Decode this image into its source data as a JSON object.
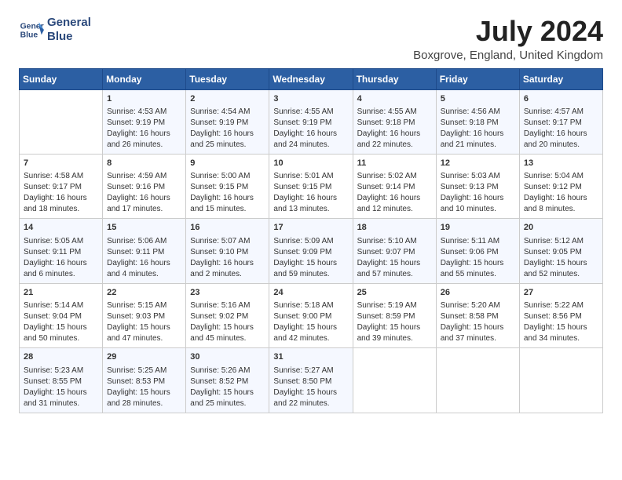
{
  "header": {
    "logo_line1": "General",
    "logo_line2": "Blue",
    "month": "July 2024",
    "location": "Boxgrove, England, United Kingdom"
  },
  "weekdays": [
    "Sunday",
    "Monday",
    "Tuesday",
    "Wednesday",
    "Thursday",
    "Friday",
    "Saturday"
  ],
  "weeks": [
    [
      {
        "day": "",
        "info": ""
      },
      {
        "day": "1",
        "info": "Sunrise: 4:53 AM\nSunset: 9:19 PM\nDaylight: 16 hours\nand 26 minutes."
      },
      {
        "day": "2",
        "info": "Sunrise: 4:54 AM\nSunset: 9:19 PM\nDaylight: 16 hours\nand 25 minutes."
      },
      {
        "day": "3",
        "info": "Sunrise: 4:55 AM\nSunset: 9:19 PM\nDaylight: 16 hours\nand 24 minutes."
      },
      {
        "day": "4",
        "info": "Sunrise: 4:55 AM\nSunset: 9:18 PM\nDaylight: 16 hours\nand 22 minutes."
      },
      {
        "day": "5",
        "info": "Sunrise: 4:56 AM\nSunset: 9:18 PM\nDaylight: 16 hours\nand 21 minutes."
      },
      {
        "day": "6",
        "info": "Sunrise: 4:57 AM\nSunset: 9:17 PM\nDaylight: 16 hours\nand 20 minutes."
      }
    ],
    [
      {
        "day": "7",
        "info": "Sunrise: 4:58 AM\nSunset: 9:17 PM\nDaylight: 16 hours\nand 18 minutes."
      },
      {
        "day": "8",
        "info": "Sunrise: 4:59 AM\nSunset: 9:16 PM\nDaylight: 16 hours\nand 17 minutes."
      },
      {
        "day": "9",
        "info": "Sunrise: 5:00 AM\nSunset: 9:15 PM\nDaylight: 16 hours\nand 15 minutes."
      },
      {
        "day": "10",
        "info": "Sunrise: 5:01 AM\nSunset: 9:15 PM\nDaylight: 16 hours\nand 13 minutes."
      },
      {
        "day": "11",
        "info": "Sunrise: 5:02 AM\nSunset: 9:14 PM\nDaylight: 16 hours\nand 12 minutes."
      },
      {
        "day": "12",
        "info": "Sunrise: 5:03 AM\nSunset: 9:13 PM\nDaylight: 16 hours\nand 10 minutes."
      },
      {
        "day": "13",
        "info": "Sunrise: 5:04 AM\nSunset: 9:12 PM\nDaylight: 16 hours\nand 8 minutes."
      }
    ],
    [
      {
        "day": "14",
        "info": "Sunrise: 5:05 AM\nSunset: 9:11 PM\nDaylight: 16 hours\nand 6 minutes."
      },
      {
        "day": "15",
        "info": "Sunrise: 5:06 AM\nSunset: 9:11 PM\nDaylight: 16 hours\nand 4 minutes."
      },
      {
        "day": "16",
        "info": "Sunrise: 5:07 AM\nSunset: 9:10 PM\nDaylight: 16 hours\nand 2 minutes."
      },
      {
        "day": "17",
        "info": "Sunrise: 5:09 AM\nSunset: 9:09 PM\nDaylight: 15 hours\nand 59 minutes."
      },
      {
        "day": "18",
        "info": "Sunrise: 5:10 AM\nSunset: 9:07 PM\nDaylight: 15 hours\nand 57 minutes."
      },
      {
        "day": "19",
        "info": "Sunrise: 5:11 AM\nSunset: 9:06 PM\nDaylight: 15 hours\nand 55 minutes."
      },
      {
        "day": "20",
        "info": "Sunrise: 5:12 AM\nSunset: 9:05 PM\nDaylight: 15 hours\nand 52 minutes."
      }
    ],
    [
      {
        "day": "21",
        "info": "Sunrise: 5:14 AM\nSunset: 9:04 PM\nDaylight: 15 hours\nand 50 minutes."
      },
      {
        "day": "22",
        "info": "Sunrise: 5:15 AM\nSunset: 9:03 PM\nDaylight: 15 hours\nand 47 minutes."
      },
      {
        "day": "23",
        "info": "Sunrise: 5:16 AM\nSunset: 9:02 PM\nDaylight: 15 hours\nand 45 minutes."
      },
      {
        "day": "24",
        "info": "Sunrise: 5:18 AM\nSunset: 9:00 PM\nDaylight: 15 hours\nand 42 minutes."
      },
      {
        "day": "25",
        "info": "Sunrise: 5:19 AM\nSunset: 8:59 PM\nDaylight: 15 hours\nand 39 minutes."
      },
      {
        "day": "26",
        "info": "Sunrise: 5:20 AM\nSunset: 8:58 PM\nDaylight: 15 hours\nand 37 minutes."
      },
      {
        "day": "27",
        "info": "Sunrise: 5:22 AM\nSunset: 8:56 PM\nDaylight: 15 hours\nand 34 minutes."
      }
    ],
    [
      {
        "day": "28",
        "info": "Sunrise: 5:23 AM\nSunset: 8:55 PM\nDaylight: 15 hours\nand 31 minutes."
      },
      {
        "day": "29",
        "info": "Sunrise: 5:25 AM\nSunset: 8:53 PM\nDaylight: 15 hours\nand 28 minutes."
      },
      {
        "day": "30",
        "info": "Sunrise: 5:26 AM\nSunset: 8:52 PM\nDaylight: 15 hours\nand 25 minutes."
      },
      {
        "day": "31",
        "info": "Sunrise: 5:27 AM\nSunset: 8:50 PM\nDaylight: 15 hours\nand 22 minutes."
      },
      {
        "day": "",
        "info": ""
      },
      {
        "day": "",
        "info": ""
      },
      {
        "day": "",
        "info": ""
      }
    ]
  ]
}
